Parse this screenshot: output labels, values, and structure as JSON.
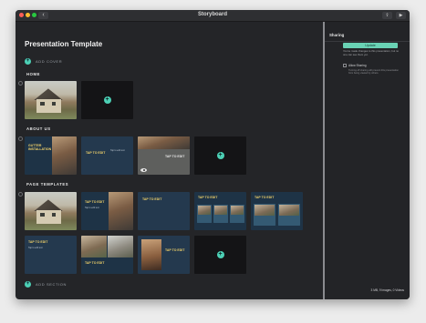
{
  "window": {
    "title": "Storyboard",
    "back_glyph": "‹",
    "share_glyph": "⇪",
    "play_glyph": "▶"
  },
  "main": {
    "page_title": "Presentation Template",
    "add_cover_label": "ADD COVER",
    "add_section_label": "ADD SECTION",
    "sections": [
      {
        "label": "HOME"
      },
      {
        "label": "ABOUT US"
      },
      {
        "label": "PAGE TEMPLATES"
      }
    ],
    "slides": {
      "tap_to_edit": "TAP TO EDIT",
      "gutter_title": "GUTTER INSTALLATION",
      "body_text": "Tap to edit text"
    },
    "add_plus": "+"
  },
  "panel": {
    "title": "Sharing",
    "update_label": "Update",
    "description": "You've made changes to this presentation, but no one can see them yet.",
    "allow_sharing_label": "Allow Sharing",
    "allow_sharing_desc": "Turning off sharing will prevent this presentation from being viewed by others.",
    "footer": "3 MB, 9 Images, 0 Videos"
  },
  "colors": {
    "accent": "#4cd0b5",
    "update_button": "#69d2b4",
    "slide_navy": "#1e3346",
    "slide_title_yellow": "#f1d26a"
  }
}
